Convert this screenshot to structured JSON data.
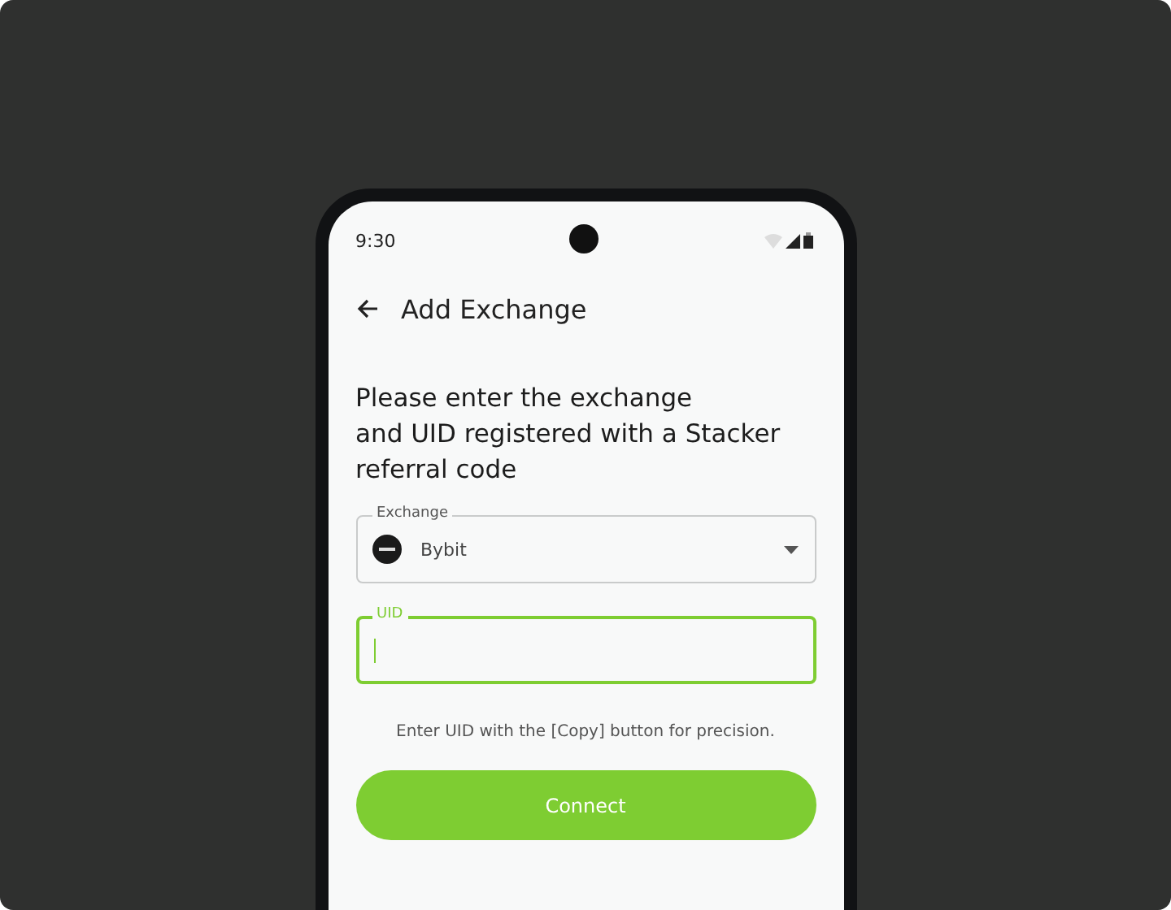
{
  "status_bar": {
    "time": "9:30"
  },
  "header": {
    "title": "Add Exchange"
  },
  "heading": "Please enter the exchange\nand UID registered with a Stacker\nreferral code",
  "exchange_field": {
    "label": "Exchange",
    "value": "Bybit"
  },
  "uid_field": {
    "label": "UID",
    "focused": true
  },
  "hint": "Enter UID with the [Copy] button for precision.",
  "button": {
    "label": "Connect"
  }
}
